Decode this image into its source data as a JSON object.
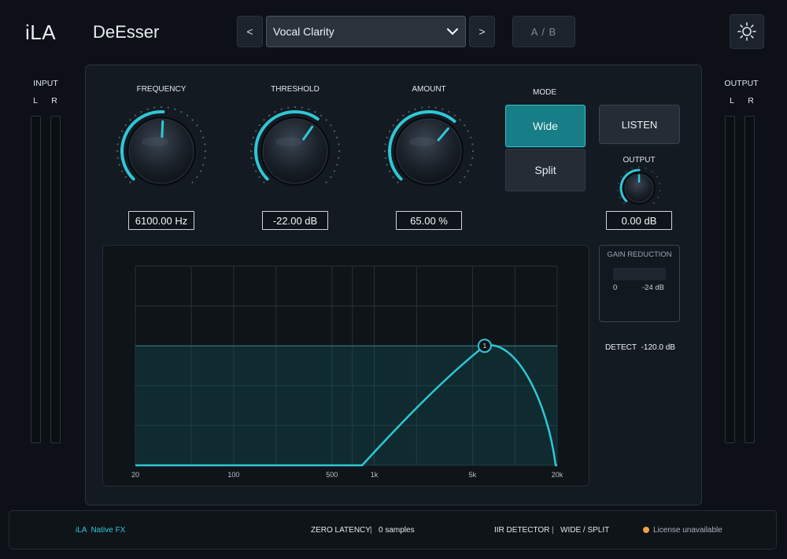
{
  "header": {
    "brand": "iLA",
    "plugin_name": "DeEsser",
    "prev_label": "<",
    "next_label": ">",
    "preset": "Vocal Clarity",
    "ab_label": "A / B"
  },
  "meters": {
    "input_label": "INPUT",
    "output_label": "OUTPUT",
    "left": "L",
    "right": "R"
  },
  "knobs": {
    "frequency": {
      "label": "FREQUENCY",
      "readout": "6100.00 Hz",
      "fraction": 0.51
    },
    "threshold": {
      "label": "THRESHOLD",
      "readout": "-22.00 dB",
      "fraction": 0.63
    },
    "amount": {
      "label": "AMOUNT",
      "readout": "65.00 %",
      "fraction": 0.65
    },
    "output": {
      "label": "OUTPUT",
      "readout": "0.00 dB",
      "fraction": 0.5
    }
  },
  "mode": {
    "label": "MODE",
    "options": [
      "Wide",
      "Split"
    ],
    "selected": "Wide"
  },
  "listen_label": "LISTEN",
  "gain_reduction": {
    "title": "GAIN REDUCTION",
    "min_label": "0",
    "max_label": "-24 dB",
    "value_fraction": 0
  },
  "detect": {
    "label": "DETECT",
    "value": "-120.0 dB"
  },
  "graph": {
    "x_ticks": [
      "20",
      "100",
      "500",
      "1k",
      "5k",
      "20k"
    ],
    "node_label": "1"
  },
  "footer": {
    "brand": "iLA  Native FX",
    "latency_label": "ZERO LATENCY",
    "latency_value": "0 samples",
    "detector_label": "IIR DETECTOR",
    "detector_modes": "WIDE / SPLIT",
    "license": "License unavailable",
    "license_dot_color": "#f0a24a"
  },
  "colors": {
    "accent": "#2fc7d6",
    "accent_fill": "#0f5c63"
  }
}
